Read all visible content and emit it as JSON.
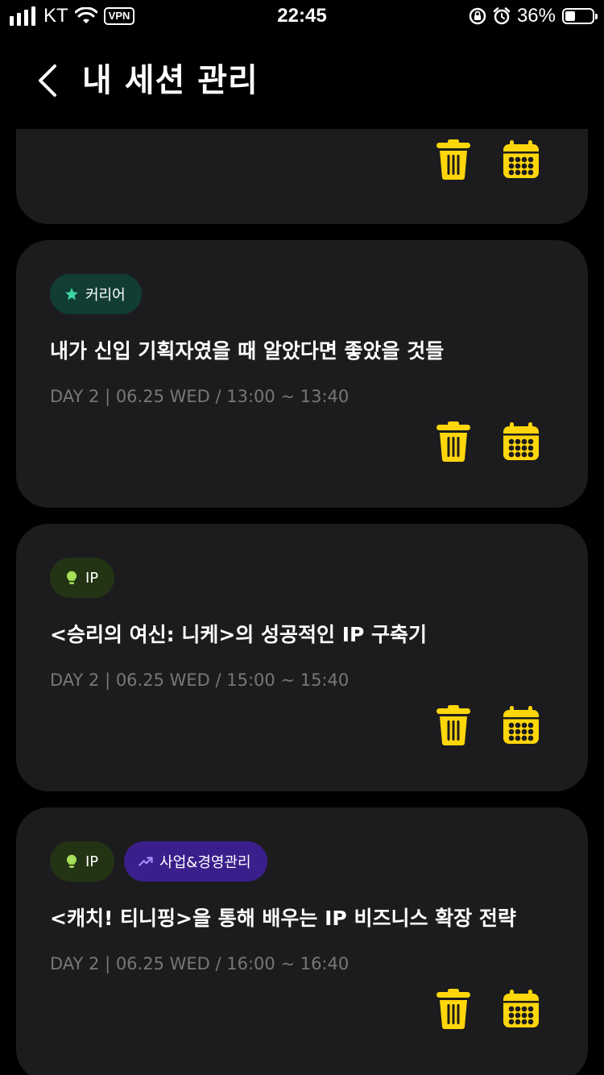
{
  "status_bar": {
    "carrier": "KT",
    "vpn_label": "VPN",
    "time": "22:45",
    "battery_percent": "36%",
    "battery_level": 0.36
  },
  "header": {
    "title": "내 세션 관리"
  },
  "colors": {
    "background": "#000000",
    "card": "#1c1c1e",
    "accent_yellow": "#ffd60a",
    "tag_career_bg": "#113d35",
    "tag_career_icon": "#3ed6a0",
    "tag_ip_bg": "#233414",
    "tag_ip_icon": "#a6e05a",
    "tag_biz_bg": "#3a1f8c",
    "tag_biz_icon": "#a88bff",
    "meta_text": "#777777"
  },
  "sessions": [
    {
      "tags": [],
      "title": "",
      "time": "",
      "partial": true
    },
    {
      "tags": [
        {
          "label": "커리어",
          "icon": "star-icon"
        }
      ],
      "title": "내가 신입 기획자였을 때 알았다면 좋았을 것들",
      "time": "DAY 2 | 06.25 WED / 13:00 ~ 13:40"
    },
    {
      "tags": [
        {
          "label": "IP",
          "icon": "lightbulb-icon"
        }
      ],
      "title": "<승리의 여신: 니케>의 성공적인 IP 구축기",
      "time": "DAY 2 | 06.25 WED / 15:00 ~ 15:40"
    },
    {
      "tags": [
        {
          "label": "IP",
          "icon": "lightbulb-icon"
        },
        {
          "label": "사업&경영관리",
          "icon": "trending-up-icon"
        }
      ],
      "title": "<캐치! 티니핑>을 통해 배우는 IP 비즈니스 확장 전략",
      "time": "DAY 2 | 06.25 WED / 16:00 ~ 16:40"
    }
  ],
  "action_icons": {
    "delete": "trash-icon",
    "calendar": "calendar-icon"
  }
}
